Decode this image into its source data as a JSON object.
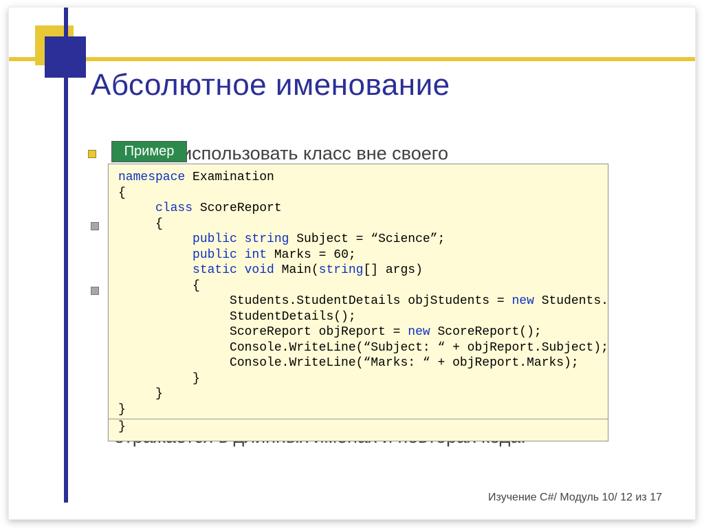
{
  "title": "Абсолютное именование",
  "badge": "Пример",
  "bullet1_fragment": "ет использовать класс вне своего",
  "bottom_line": "отражается в длинных именах и повторах кода.",
  "footer": "Изучение C#/ Модуль 10/ 12 из 17",
  "code": {
    "l1a": "namespace",
    "l1b": " Examination",
    "l2": "{",
    "l3a": "     class",
    "l3b": " ScoreReport",
    "l4": "     {",
    "l5a": "          public string",
    "l5b": " Subject = “Science”;",
    "l6a": "          public int",
    "l6b": " Marks = 60;",
    "l7a": "          static void",
    "l7b": " Main(",
    "l7c": "string",
    "l7d": "[] args)",
    "l8": "          {",
    "l9a": "               Students.StudentDetails objStudents = ",
    "l9b": "new",
    "l9c": " Students.",
    "l10": "               StudentDetails();",
    "l11a": "               ScoreReport objReport = ",
    "l11b": "new",
    "l11c": " ScoreReport();",
    "l12": "               Console.WriteLine(“Subject: “ + objReport.Subject);",
    "l13": "               Console.WriteLine(“Marks: “ + objReport.Marks);",
    "l14": "          }",
    "l15": "     }",
    "l16": "}",
    "l17": "}"
  }
}
